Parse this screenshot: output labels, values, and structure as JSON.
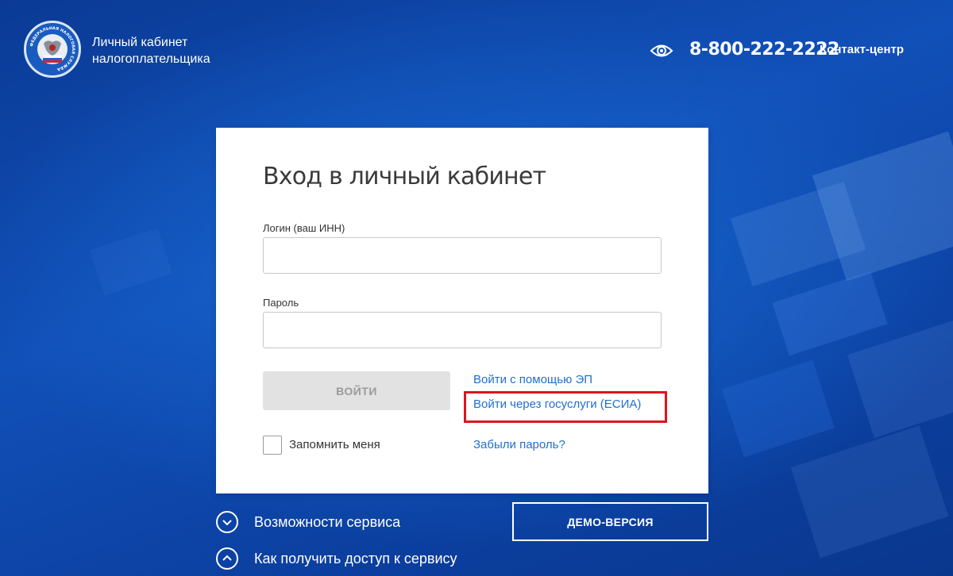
{
  "header": {
    "logo_ring_text": "ФЕДЕРАЛЬНАЯ НАЛОГОВАЯ СЛУЖБА",
    "brand_line1": "Личный кабинет",
    "brand_line2": "налогоплательщика",
    "visually_impaired_icon": "eye-icon",
    "phone": "8-800-222-2222",
    "contact_center": "Контакт-центр"
  },
  "login_form": {
    "title": "Вход в личный кабинет",
    "login_label": "Логин (ваш ИНН)",
    "login_value": "",
    "password_label": "Пароль",
    "password_value": "",
    "submit_label": "ВОЙТИ",
    "link_ep": "Войти с помощью ЭП",
    "link_esia": "Войти через госуслуги (ЕСИА)",
    "link_forgot": "Забыли пароль?",
    "remember_label": "Запомнить меня",
    "remember_checked": false,
    "highlight_color": "#e0131d"
  },
  "bottom": {
    "features_label": "Возможности сервиса",
    "features_icon": "chevron-down-circle-icon",
    "access_label": "Как получить доступ к сервису",
    "access_icon": "chevron-up-circle-icon",
    "demo_label": "ДЕМО-ВЕРСИЯ"
  },
  "colors": {
    "background": "#0d3f9e",
    "link": "#1f6fcf",
    "button_disabled": "#e2e2e2"
  }
}
